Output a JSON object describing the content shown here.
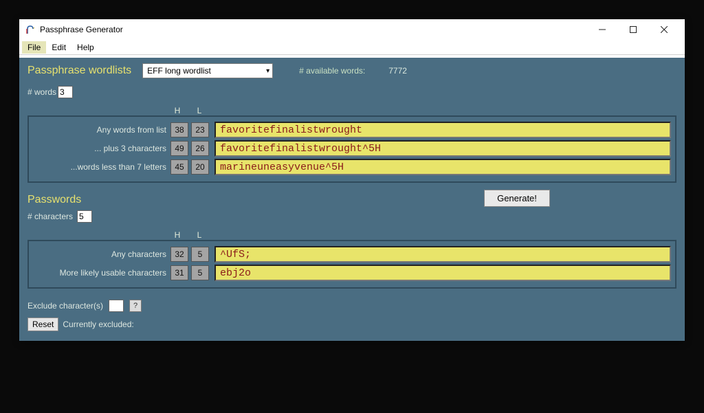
{
  "window": {
    "title": "Passphrase Generator"
  },
  "menu": {
    "file": "File",
    "edit": "Edit",
    "help": "Help"
  },
  "wordlists": {
    "title": "Passphrase wordlists",
    "selected": "EFF long wordlist",
    "avail_label": "# available words:",
    "avail_count": "7772",
    "num_words_label": "# words",
    "num_words_value": "3",
    "col_h": "H",
    "col_l": "L",
    "rows": [
      {
        "label": "Any words from list",
        "h": "38",
        "l": "23",
        "out": "favoritefinalistwrought"
      },
      {
        "label": "... plus 3 characters",
        "h": "49",
        "l": "26",
        "out": "favoritefinalistwrought^5H"
      },
      {
        "label": "...words less than 7 letters",
        "h": "45",
        "l": "20",
        "out": "marineuneasyvenue^5H"
      }
    ]
  },
  "generate_label": "Generate!",
  "passwords": {
    "title": "Passwords",
    "num_chars_label": "# characters",
    "num_chars_value": "5",
    "col_h": "H",
    "col_l": "L",
    "rows": [
      {
        "label": "Any characters",
        "h": "32",
        "l": "5",
        "out": "^UfS;"
      },
      {
        "label": "More likely usable characters",
        "h": "31",
        "l": "5",
        "out": "ebj2o"
      }
    ]
  },
  "exclude": {
    "label": "Exclude character(s)",
    "value": "",
    "help": "?",
    "reset": "Reset",
    "currently_label": "Currently excluded:",
    "currently_value": ""
  }
}
